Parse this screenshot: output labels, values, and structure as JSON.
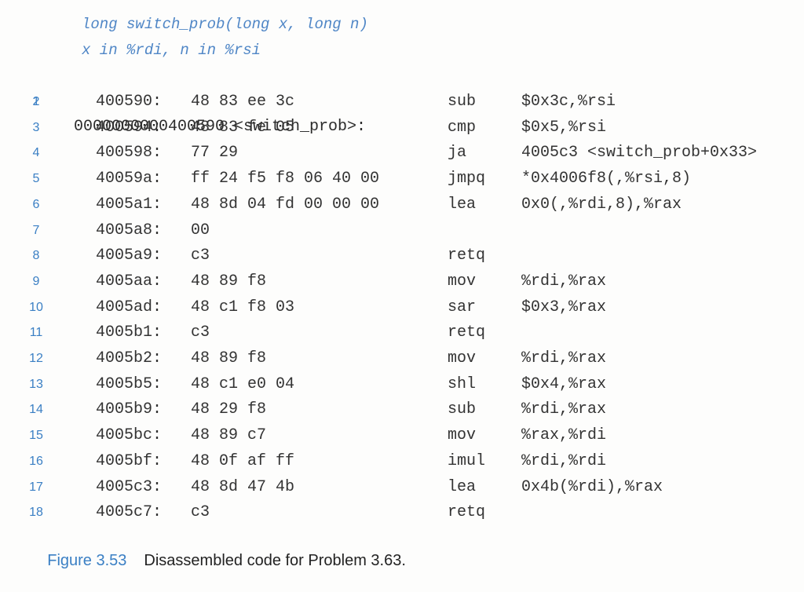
{
  "header_comment": {
    "signature": "long switch_prob(long x, long n)",
    "registers": "x in %rdi, n in %rsi"
  },
  "colors": {
    "accent_blue": "#3a7fc4",
    "comment_blue": "#4f86c6",
    "text": "#2a2a2a"
  },
  "listing": {
    "header_line": {
      "number": "1",
      "text": "0000000000400590 <switch_prob>:"
    },
    "lines": [
      {
        "number": "2",
        "addr": "400590:",
        "bytes": "48 83 ee 3c",
        "mnemonic": "sub",
        "operands": "$0x3c,%rsi"
      },
      {
        "number": "3",
        "addr": "400594:",
        "bytes": "48 83 fe 05",
        "mnemonic": "cmp",
        "operands": "$0x5,%rsi"
      },
      {
        "number": "4",
        "addr": "400598:",
        "bytes": "77 29",
        "mnemonic": "ja",
        "operands": "4005c3 <switch_prob+0x33>"
      },
      {
        "number": "5",
        "addr": "40059a:",
        "bytes": "ff 24 f5 f8 06 40 00",
        "mnemonic": "jmpq",
        "operands": "*0x4006f8(,%rsi,8)"
      },
      {
        "number": "6",
        "addr": "4005a1:",
        "bytes": "48 8d 04 fd 00 00 00",
        "mnemonic": "lea",
        "operands": "0x0(,%rdi,8),%rax"
      },
      {
        "number": "7",
        "addr": "4005a8:",
        "bytes": "00",
        "mnemonic": "",
        "operands": ""
      },
      {
        "number": "8",
        "addr": "4005a9:",
        "bytes": "c3",
        "mnemonic": "retq",
        "operands": ""
      },
      {
        "number": "9",
        "addr": "4005aa:",
        "bytes": "48 89 f8",
        "mnemonic": "mov",
        "operands": "%rdi,%rax"
      },
      {
        "number": "10",
        "addr": "4005ad:",
        "bytes": "48 c1 f8 03",
        "mnemonic": "sar",
        "operands": "$0x3,%rax"
      },
      {
        "number": "11",
        "addr": "4005b1:",
        "bytes": "c3",
        "mnemonic": "retq",
        "operands": ""
      },
      {
        "number": "12",
        "addr": "4005b2:",
        "bytes": "48 89 f8",
        "mnemonic": "mov",
        "operands": "%rdi,%rax"
      },
      {
        "number": "13",
        "addr": "4005b5:",
        "bytes": "48 c1 e0 04",
        "mnemonic": "shl",
        "operands": "$0x4,%rax"
      },
      {
        "number": "14",
        "addr": "4005b9:",
        "bytes": "48 29 f8",
        "mnemonic": "sub",
        "operands": "%rdi,%rax"
      },
      {
        "number": "15",
        "addr": "4005bc:",
        "bytes": "48 89 c7",
        "mnemonic": "mov",
        "operands": "%rax,%rdi"
      },
      {
        "number": "16",
        "addr": "4005bf:",
        "bytes": "48 0f af ff",
        "mnemonic": "imul",
        "operands": "%rdi,%rdi"
      },
      {
        "number": "17",
        "addr": "4005c3:",
        "bytes": "48 8d 47 4b",
        "mnemonic": "lea",
        "operands": "0x4b(%rdi),%rax"
      },
      {
        "number": "18",
        "addr": "4005c7:",
        "bytes": "c3",
        "mnemonic": "retq",
        "operands": ""
      }
    ]
  },
  "caption": {
    "label": "Figure 3.53",
    "text": "Disassembled code for Problem 3.63."
  }
}
